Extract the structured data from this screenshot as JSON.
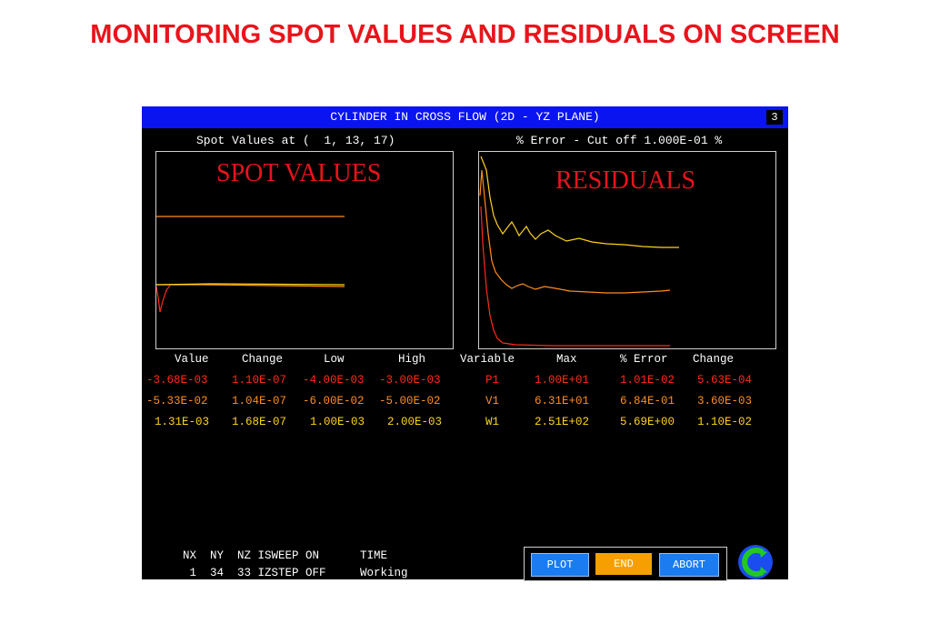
{
  "slide_title": "MONITORING SPOT VALUES AND RESIDUALS ON SCREEN",
  "window": {
    "title": "CYLINDER IN CROSS FLOW (2D - YZ PLANE)",
    "number": "3"
  },
  "left_header": "Spot Values at (  1, 13, 17)",
  "right_header": "% Error - Cut off 1.000E-01 %",
  "overlay_labels": {
    "spot": "SPOT VALUES",
    "residuals": "RESIDUALS"
  },
  "spot_table": {
    "headers": [
      "Value",
      "Change",
      "Low",
      "High"
    ],
    "rows": [
      [
        "-3.68E-03",
        "1.10E-07",
        "-4.00E-03",
        "-3.00E-03"
      ],
      [
        "-5.33E-02",
        "1.04E-07",
        "-6.00E-02",
        "-5.00E-02"
      ],
      [
        "1.31E-03",
        "1.68E-07",
        "1.00E-03",
        "2.00E-03"
      ]
    ]
  },
  "residual_table": {
    "headers": [
      "Variable",
      "Max",
      "% Error",
      "Change"
    ],
    "rows": [
      [
        "P1",
        "1.00E+01",
        "1.01E-02",
        "5.63E-04"
      ],
      [
        "V1",
        "6.31E+01",
        "6.84E-01",
        "3.60E-03"
      ],
      [
        "W1",
        "2.51E+02",
        "5.69E+00",
        "1.10E-02"
      ]
    ]
  },
  "row_colors": [
    "#ff2a1a",
    "#ff8c1a",
    "#ffd21a"
  ],
  "status": {
    "header": "NX  NY  NZ ISWEEP ON      TIME",
    "values": " 1  34  33 IZSTEP OFF     Working"
  },
  "buttons": {
    "plot": "PLOT",
    "end": "END",
    "abort": "ABORT"
  },
  "colors": {
    "titlebar": "#0a14f0",
    "button_blue": "#1a7cf0",
    "button_orange": "#f5a000",
    "slide_title": "#e8141c"
  }
}
